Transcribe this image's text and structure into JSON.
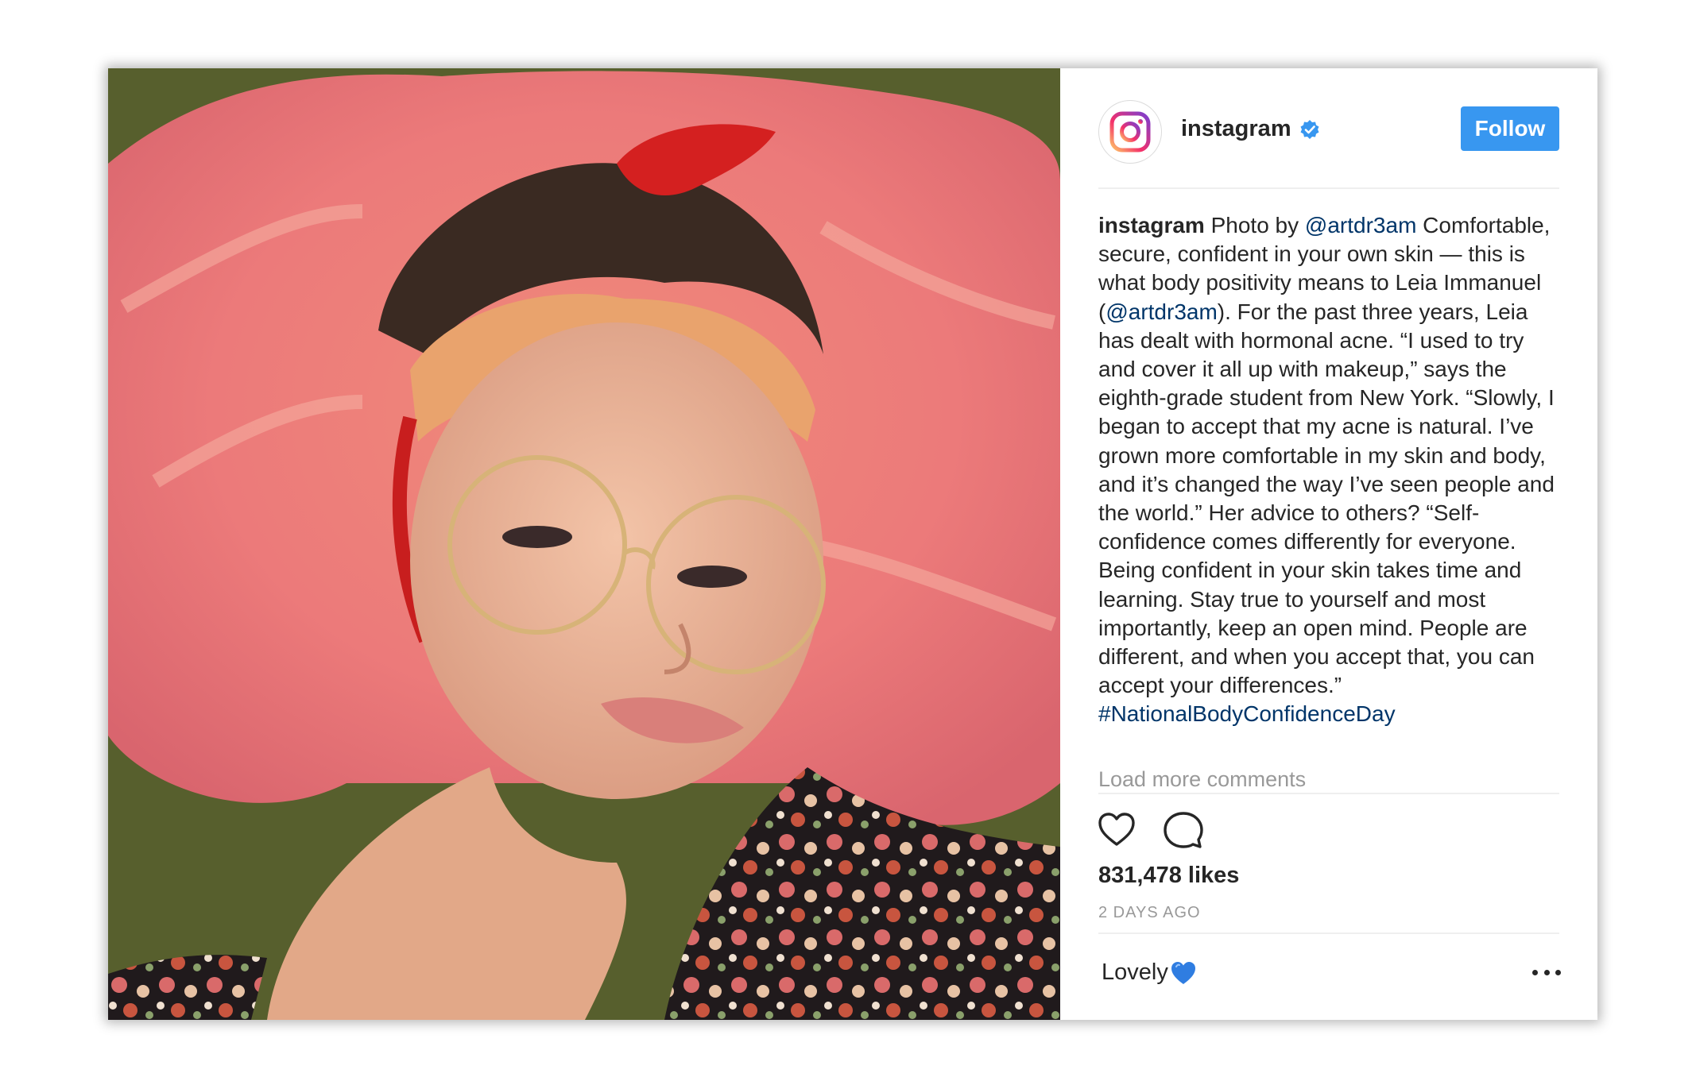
{
  "post": {
    "author": "instagram",
    "verified": true,
    "follow_label": "Follow",
    "caption": {
      "user": "instagram",
      "prefix": "Photo by",
      "mention_1": "@artdr3am",
      "body_1": "Comfortable, secure, confident in your own skin — this is what body positivity means to Leia Immanuel (",
      "mention_2": "@artdr3am",
      "body_2": "). For the past three years, Leia has dealt with hormonal acne. “I used to try and cover it all up with makeup,” says the eighth-grade student from New York. “Slowly, I began to accept that my acne is natural. I’ve grown more comfortable in my skin and body, and it’s changed the way I’ve seen people and the world.” Her advice to others? “Self-confidence comes differently for everyone. Being confident in your skin takes time and learning. Stay true to yourself and most importantly, keep an open mind. People are different, and when you accept that, you can accept your differences.”",
      "hashtag": "#NationalBodyConfidenceDay"
    },
    "load_more_label": "Load more comments",
    "likes": "831,478 likes",
    "timestamp": "2 DAYS AGO",
    "comment_input_value": "Lovely",
    "icons": {
      "avatar": "instagram-logo-icon",
      "verified": "verified-badge-icon",
      "like": "heart-outline-icon",
      "comment": "speech-bubble-icon",
      "emoji": "blue-heart-emoji-icon",
      "more": "more-options-icon"
    },
    "colors": {
      "follow_button": "#3897f0",
      "link": "#003569",
      "muted": "#999999",
      "text": "#262626"
    }
  }
}
